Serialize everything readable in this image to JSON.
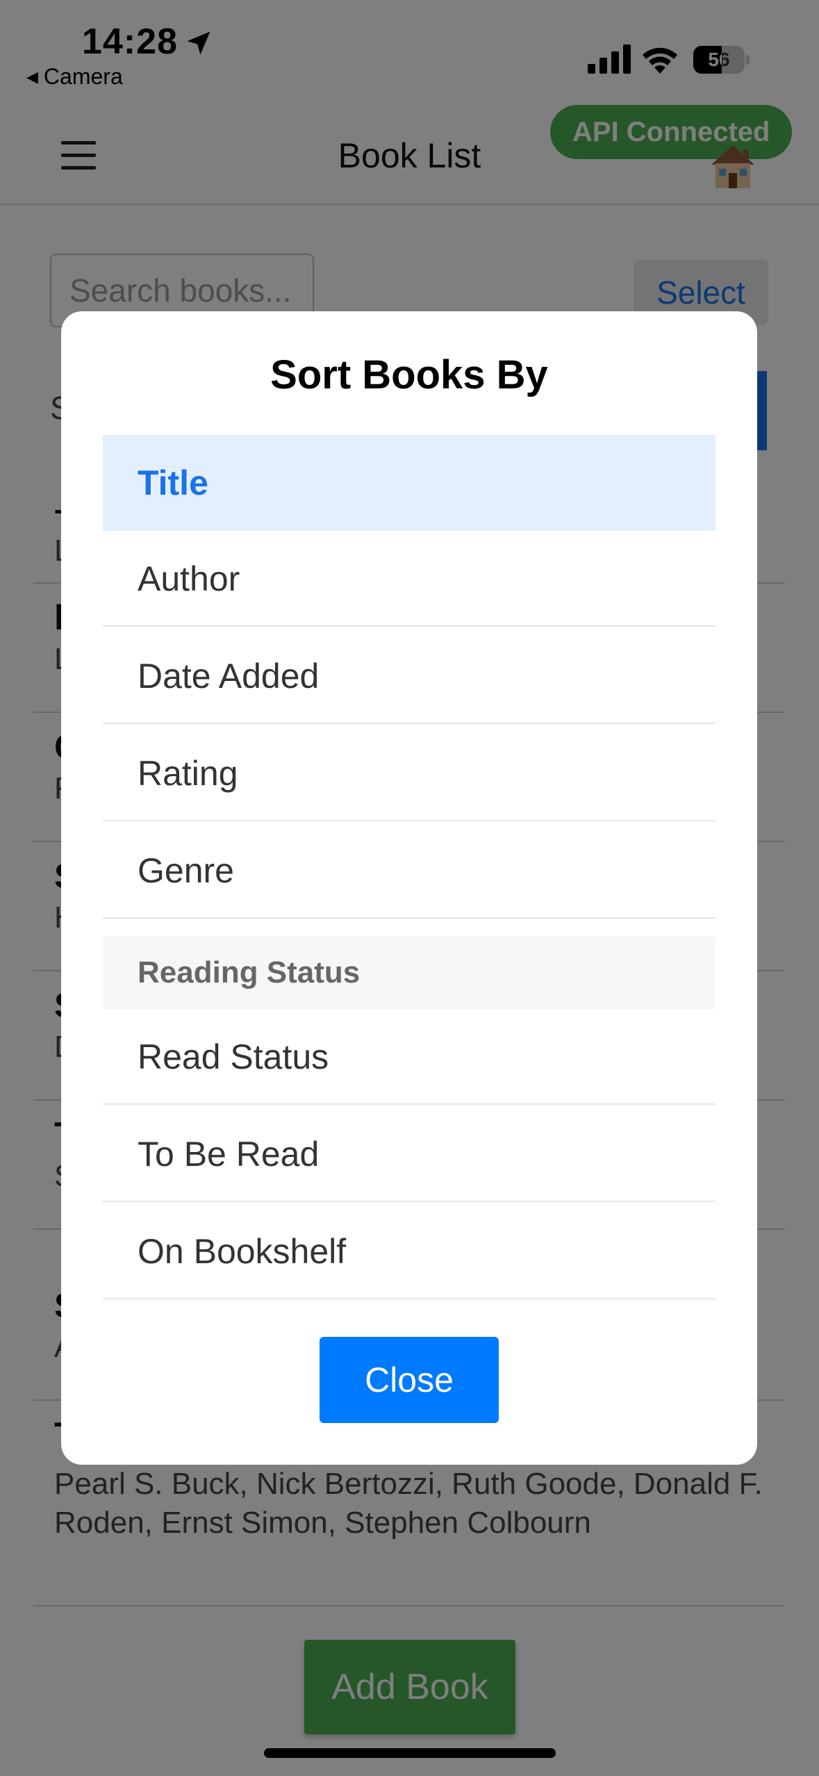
{
  "status_bar": {
    "time": "14:28",
    "back_label": "Camera",
    "battery_percent": 56,
    "battery_text": "56"
  },
  "header": {
    "title": "Book List",
    "api_status": "API Connected",
    "home_emoji": "🏠"
  },
  "toolbar": {
    "search_placeholder": "Search books...",
    "select_label": "Select",
    "sort_label_partial": "S"
  },
  "books_peek": [
    {
      "title": "–",
      "author": "L"
    },
    {
      "title": "l",
      "author": "L"
    },
    {
      "title": "C",
      "author": "F"
    },
    {
      "title": "S",
      "author": "H"
    },
    {
      "title": "S",
      "author": "D"
    },
    {
      "title": "T",
      "author": "S"
    },
    {
      "title": "S",
      "author": "A"
    },
    {
      "title": "T",
      "author": ""
    }
  ],
  "last_book_authors": "Pearl S. Buck, Nick Bertozzi, Ruth Goode, Donald F. Roden, Ernst Simon, Stephen Colbourn",
  "add_book_label": "Add Book",
  "modal": {
    "title": "Sort Books By",
    "options": [
      "Title",
      "Author",
      "Date Added",
      "Rating",
      "Genre"
    ],
    "selected": "Title",
    "section_header": "Reading Status",
    "status_options": [
      "Read Status",
      "To Be Read",
      "On Bookshelf"
    ],
    "close_label": "Close"
  },
  "colors": {
    "accent": "#1a73e8",
    "api_green": "#4caf50",
    "close_blue": "#007aff",
    "selected_bg": "#e3effd"
  }
}
